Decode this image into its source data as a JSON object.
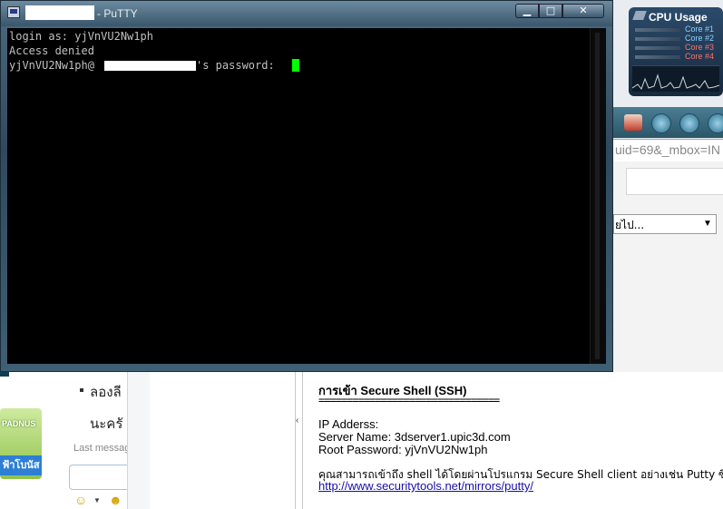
{
  "putty": {
    "title": "- PuTTY",
    "buttons": {
      "minimize": "▁",
      "maximize": "□",
      "close": "✕"
    },
    "terminal": {
      "line1": "login as: yjVnVU2Nw1ph",
      "line2": "Access denied",
      "line3_prefix": "yjVnVU2Nw1ph@",
      "line3_suffix": "'s password: "
    },
    "cursor_color": "#00ff00"
  },
  "cpu_gadget": {
    "title": "CPU Usage",
    "cores": [
      {
        "label": "Core #1",
        "color": "#8fd0ff"
      },
      {
        "label": "Core #2",
        "color": "#8fd0ff"
      },
      {
        "label": "Core #3",
        "color": "#ff7070"
      },
      {
        "label": "Core #4",
        "color": "#ff7070"
      }
    ]
  },
  "browser": {
    "url_fragment": "uid=69&_mbox=IN",
    "select_value": "ยไป...",
    "select_arrow": "▼"
  },
  "chat": {
    "item1": "ลองลี",
    "item2": "นะครั",
    "last_message": "Last messag",
    "banner_top": "PADNUS",
    "banner_bottom": "ฟ้าโบนัส",
    "emoji": "☺",
    "emoji_caret": "▼",
    "wink": "☻",
    "splitter_arrow": "‹"
  },
  "ssh_info": {
    "title": "การเข้า Secure Shell (SSH)",
    "rule": "================================",
    "ip_label": "IP Adderss:",
    "server_name": "Server Name: 3dserver1.upic3d.com",
    "root_password": "Root Password: yjVnVU2Nw1ph",
    "description": "คุณสามารถเข้าถึง shell ได้โดยผ่านโปรแกรม Secure Shell client อย่างเช่น Putty ซึ่งส",
    "link": "http://www.securitytools.net/mirrors/putty/"
  }
}
